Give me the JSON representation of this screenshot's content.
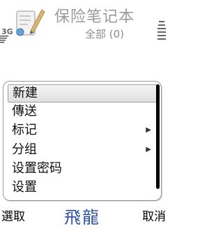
{
  "status": {
    "network": "3G"
  },
  "header": {
    "title": "保险笔记本",
    "subtitle": "全部 (0)"
  },
  "menu": {
    "items": [
      {
        "label": "新建",
        "submenu": false
      },
      {
        "label": "傳送",
        "submenu": false
      },
      {
        "label": "标记",
        "submenu": true
      },
      {
        "label": "分组",
        "submenu": true
      },
      {
        "label": "设置密码",
        "submenu": false
      },
      {
        "label": "设置",
        "submenu": false
      }
    ],
    "selected_index": 0
  },
  "softkeys": {
    "left": "選取",
    "center_logo": "飛龍",
    "right": "取消"
  },
  "icons": {
    "app": "notebook-pen-icon",
    "submenu": "triangle-right-icon"
  }
}
